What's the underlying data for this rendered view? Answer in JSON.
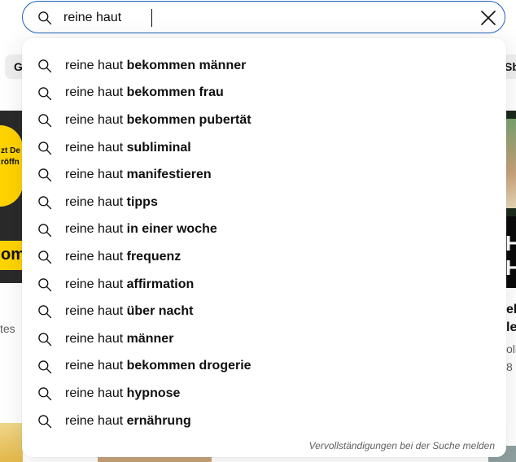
{
  "search": {
    "query": "reine haut",
    "clear_icon": "close-icon",
    "search_icon": "search-icon"
  },
  "suggestions": [
    {
      "prefix": "reine haut",
      "completion": "bekommen männer"
    },
    {
      "prefix": "reine haut",
      "completion": "bekommen frau"
    },
    {
      "prefix": "reine haut",
      "completion": "bekommen pubertät"
    },
    {
      "prefix": "reine haut",
      "completion": "subliminal"
    },
    {
      "prefix": "reine haut",
      "completion": "manifestieren"
    },
    {
      "prefix": "reine haut",
      "completion": "tipps"
    },
    {
      "prefix": "reine haut",
      "completion": "in einer woche"
    },
    {
      "prefix": "reine haut",
      "completion": "frequenz"
    },
    {
      "prefix": "reine haut",
      "completion": "affirmation"
    },
    {
      "prefix": "reine haut",
      "completion": "über nacht"
    },
    {
      "prefix": "reine haut",
      "completion": "männer"
    },
    {
      "prefix": "reine haut",
      "completion": "bekommen drogerie"
    },
    {
      "prefix": "reine haut",
      "completion": "hypnose"
    },
    {
      "prefix": "reine haut",
      "completion": "ernährung"
    }
  ],
  "report_link": "Vervollständigungen bei der Suche melden",
  "background": {
    "chip_left": "G",
    "chip_right": "Sb",
    "thumb_left_line1": "zt De",
    "thumb_left_line2": "röffn",
    "thumb_left_line3": "om",
    "meta_left": "tes",
    "thumb_right_letters": "H\nHA",
    "meta_right_title_1": "ell",
    "meta_right_title_2": "le",
    "meta_right_sub_1": "oli",
    "meta_right_sub_2": "8"
  },
  "colors": {
    "focus_border": "#1c62b9",
    "text": "#0f0f0f",
    "secondary_text": "#606060"
  }
}
